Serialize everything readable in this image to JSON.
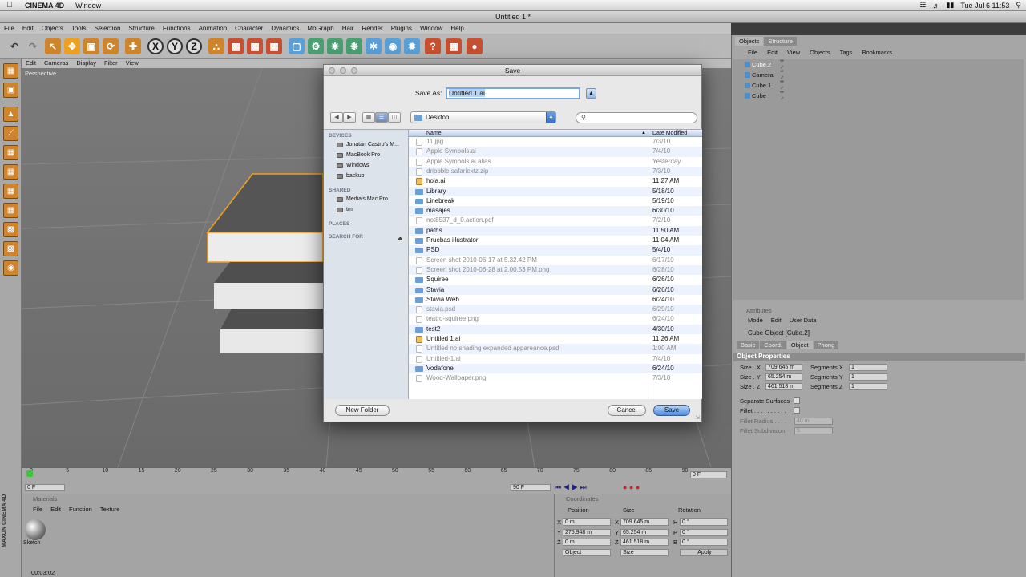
{
  "menubar": {
    "app": "CINEMA 4D",
    "window_menu": "Window",
    "clock": "Tue Jul 6  11:53"
  },
  "window": {
    "title": "Untitled 1 *"
  },
  "app_menu": [
    "File",
    "Edit",
    "Objects",
    "Tools",
    "Selection",
    "Structure",
    "Functions",
    "Animation",
    "Character",
    "Dynamics",
    "MoGraph",
    "Hair",
    "Render",
    "Plugins",
    "Window",
    "Help"
  ],
  "view_menu": [
    "Edit",
    "Cameras",
    "Display",
    "Filter",
    "View"
  ],
  "viewport": {
    "label": "Perspective"
  },
  "timeline": {
    "ticks": [
      "0",
      "5",
      "10",
      "15",
      "20",
      "25",
      "30",
      "35",
      "40",
      "45",
      "50",
      "55",
      "60",
      "65",
      "70",
      "75",
      "80",
      "85",
      "90"
    ],
    "start": "0 F",
    "end": "90 F",
    "current": "0 F"
  },
  "materials": {
    "title": "Materials",
    "menu": [
      "File",
      "Edit",
      "Function",
      "Texture"
    ],
    "item": "Sketch"
  },
  "coordinates": {
    "title": "Coordinates",
    "headers": [
      "Position",
      "Size",
      "Rotation"
    ],
    "rows": [
      {
        "axis": "X",
        "pos": "0 m",
        "size_axis": "X",
        "size": "709.645 m",
        "rot_axis": "H",
        "rot": "0 °"
      },
      {
        "axis": "Y",
        "pos": "275.948 m",
        "size_axis": "Y",
        "size": "65.254 m",
        "rot_axis": "P",
        "rot": "0 °"
      },
      {
        "axis": "Z",
        "pos": "0 m",
        "size_axis": "Z",
        "size": "461.518 m",
        "rot_axis": "B",
        "rot": "0 °"
      }
    ],
    "mode1": "Object",
    "mode2": "Size",
    "apply": "Apply"
  },
  "status": {
    "time": "00:03:02"
  },
  "objects_panel": {
    "tabs": [
      "Objects",
      "Structure"
    ],
    "menu": [
      "File",
      "Edit",
      "View",
      "Objects",
      "Tags",
      "Bookmarks"
    ],
    "items": [
      "Cube.2",
      "Camera",
      "Cube.1",
      "Cube"
    ]
  },
  "attributes": {
    "title": "Attributes",
    "menu": [
      "Mode",
      "Edit",
      "User Data"
    ],
    "object_name": "Cube Object [Cube.2]",
    "tabs": [
      "Basic",
      "Coord.",
      "Object",
      "Phong"
    ],
    "section": "Object Properties",
    "size_x": "709.645 m",
    "size_y": "65.254 m",
    "size_z": "461.518 m",
    "seg_x": "1",
    "seg_y": "1",
    "seg_z": "1",
    "label_size_x": "Size . X",
    "label_size_y": "Size . Y",
    "label_size_z": "Size . Z",
    "label_seg_x": "Segments X",
    "label_seg_y": "Segments Y",
    "label_seg_z": "Segments Z",
    "separate_surfaces": "Separate Surfaces",
    "fillet": "Fillet . . . . . . . . . .",
    "fillet_radius": "Fillet Radius . . . .",
    "fillet_radius_val": "40 m",
    "fillet_subdivision": "Fillet Subdivision",
    "fillet_subdivision_val": "5"
  },
  "dialog": {
    "title": "Save",
    "save_as_label": "Save As:",
    "filename": "Untitled 1.ai",
    "location": "Desktop",
    "search_placeholder": "",
    "sidebar": {
      "devices_head": "DEVICES",
      "devices": [
        "Jonatan Castro's M...",
        "MacBook Pro",
        "Windows",
        "backup"
      ],
      "shared_head": "SHARED",
      "shared": [
        "Media's Mac Pro",
        "tm"
      ],
      "places_head": "PLACES",
      "search_head": "SEARCH FOR"
    },
    "columns": {
      "name": "Name",
      "date": "Date Modified"
    },
    "files": [
      {
        "name": "11.jpg",
        "date": "7/3/10",
        "kind": "file"
      },
      {
        "name": "Apple Symbols.ai",
        "date": "7/4/10",
        "kind": "file"
      },
      {
        "name": "Apple Symbols.ai alias",
        "date": "Yesterday",
        "kind": "file"
      },
      {
        "name": "dribbble.safariextz.zip",
        "date": "7/3/10",
        "kind": "file"
      },
      {
        "name": "hola.ai",
        "date": "11:27 AM",
        "kind": "ai"
      },
      {
        "name": "Library",
        "date": "5/18/10",
        "kind": "dir"
      },
      {
        "name": "Linebreak",
        "date": "5/19/10",
        "kind": "dir"
      },
      {
        "name": "masajes",
        "date": "6/30/10",
        "kind": "dir"
      },
      {
        "name": "not8537_d_0.action.pdf",
        "date": "7/2/10",
        "kind": "file"
      },
      {
        "name": "paths",
        "date": "11:50 AM",
        "kind": "dir"
      },
      {
        "name": "Pruebas illustrator",
        "date": "11:04 AM",
        "kind": "dir"
      },
      {
        "name": "PSD",
        "date": "5/4/10",
        "kind": "dir"
      },
      {
        "name": "Screen shot 2010-06-17 at 5.32.42 PM",
        "date": "6/17/10",
        "kind": "file"
      },
      {
        "name": "Screen shot 2010-06-28 at 2.00.53 PM.png",
        "date": "6/28/10",
        "kind": "file"
      },
      {
        "name": "Squiree",
        "date": "6/26/10",
        "kind": "dir"
      },
      {
        "name": "Stavia",
        "date": "6/26/10",
        "kind": "dir"
      },
      {
        "name": "Stavia Web",
        "date": "6/24/10",
        "kind": "dir"
      },
      {
        "name": "stavia.psd",
        "date": "6/29/10",
        "kind": "file"
      },
      {
        "name": "teatro-squiree.png",
        "date": "6/24/10",
        "kind": "file"
      },
      {
        "name": "test2",
        "date": "4/30/10",
        "kind": "dir"
      },
      {
        "name": "Untitled 1.ai",
        "date": "11:26 AM",
        "kind": "ai"
      },
      {
        "name": "Untitled no shading expanded appareance.psd",
        "date": "1:00 AM",
        "kind": "file"
      },
      {
        "name": "Untitled-1.ai",
        "date": "7/4/10",
        "kind": "file"
      },
      {
        "name": "Vodafone",
        "date": "6/24/10",
        "kind": "dir"
      },
      {
        "name": "Wood-Wallpaper.png",
        "date": "7/3/10",
        "kind": "file"
      }
    ],
    "new_folder": "New Folder",
    "cancel": "Cancel",
    "save": "Save"
  },
  "colors": {
    "accent": "#3b7fd9",
    "toolbar_orange": "#d0842a",
    "selection_highlight": "#f0a020"
  },
  "brand": "MAXON CINEMA 4D"
}
